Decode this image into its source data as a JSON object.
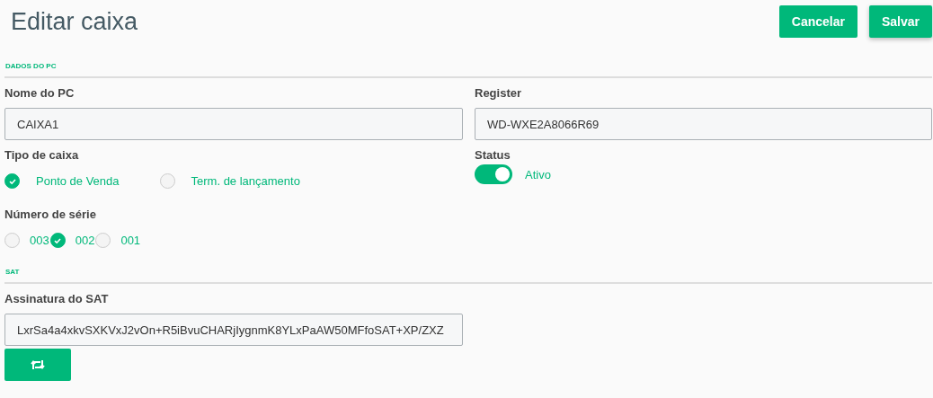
{
  "title": "Editar caixa",
  "buttons": [
    {
      "label": "Cancelar"
    },
    {
      "label": "Salvar"
    }
  ],
  "sections": [
    {
      "heading": "DADOS DO PC"
    },
    {
      "heading": "SAT"
    }
  ],
  "nome_do_pc": {
    "label": "Nome do PC",
    "value": "CAIXA1"
  },
  "register": {
    "label": "Register",
    "value": "WD-WXE2A8066R69"
  },
  "tipo_de_caixa": {
    "label": "Tipo de caixa",
    "options": [
      {
        "label": "Ponto de Venda",
        "selected": true
      },
      {
        "label": "Term. de lançamento",
        "selected": false
      }
    ]
  },
  "status": {
    "label": "Status",
    "on": true,
    "text": "Ativo"
  },
  "numero_de_serie": {
    "label": "Número de série",
    "options": [
      {
        "label": "003",
        "selected": false
      },
      {
        "label": "002",
        "selected": true
      },
      {
        "label": "001",
        "selected": false
      }
    ]
  },
  "assinatura_do_sat": {
    "label": "Assinatura do SAT",
    "value": "LxrSa4a4xkvSXKVxJ2vOn+R5iBvuCHARjIygnmK8YLxPaAW50MFfoSAT+XP/ZXZ"
  }
}
